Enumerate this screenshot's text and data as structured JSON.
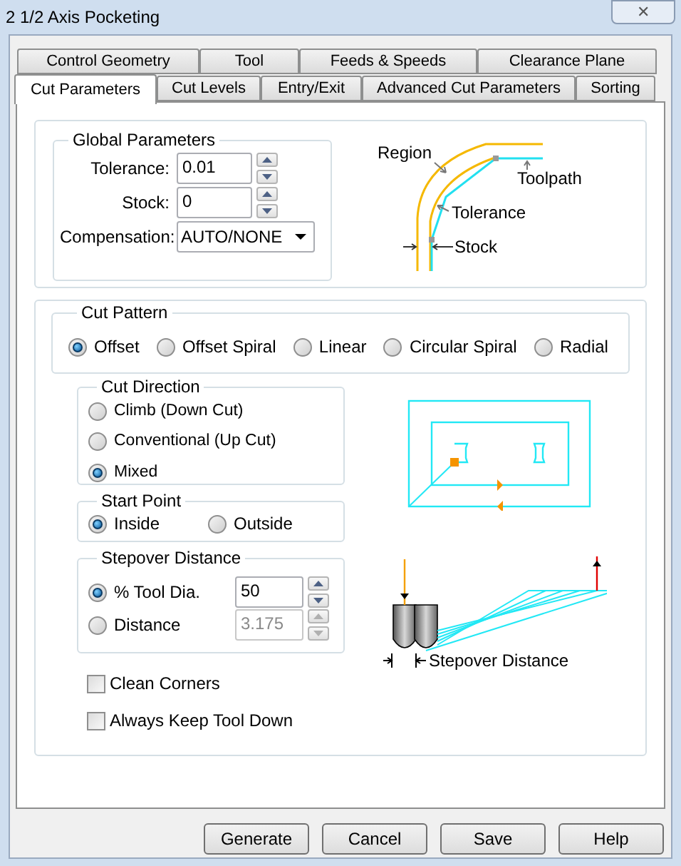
{
  "window": {
    "title": "2 1/2 Axis Pocketing",
    "close": "✕"
  },
  "tabs": [
    [
      {
        "label": "Control Geometry",
        "selected": false
      },
      {
        "label": "Tool",
        "selected": false
      },
      {
        "label": "Feeds & Speeds",
        "selected": false
      },
      {
        "label": "Clearance Plane",
        "selected": false
      }
    ],
    [
      {
        "label": "Cut Parameters",
        "selected": true
      },
      {
        "label": "Cut Levels",
        "selected": false
      },
      {
        "label": "Entry/Exit",
        "selected": false
      },
      {
        "label": "Advanced Cut Parameters",
        "selected": false
      },
      {
        "label": "Sorting",
        "selected": false
      }
    ]
  ],
  "global_parameters": {
    "title": "Global Parameters",
    "fields": [
      {
        "kind": "spinner",
        "label": "Tolerance:",
        "value": "0.01"
      },
      {
        "kind": "spinner",
        "label": "Stock:",
        "value": "0"
      },
      {
        "kind": "dropdown",
        "label": "Compensation:",
        "value": "AUTO/NONE"
      }
    ]
  },
  "region_diagram": {
    "labels": [
      "Region",
      "Toolpath",
      "Tolerance",
      "Stock"
    ]
  },
  "cut_pattern": {
    "title": "Cut Pattern",
    "options": [
      {
        "label": "Offset",
        "selected": true
      },
      {
        "label": "Offset Spiral",
        "selected": false
      },
      {
        "label": "Linear",
        "selected": false
      },
      {
        "label": "Circular Spiral",
        "selected": false
      },
      {
        "label": "Radial",
        "selected": false
      }
    ]
  },
  "cut_direction": {
    "title": "Cut Direction",
    "options": [
      {
        "label": "Climb (Down Cut)",
        "selected": false
      },
      {
        "label": "Conventional (Up Cut)",
        "selected": false
      },
      {
        "label": "Mixed",
        "selected": true
      }
    ]
  },
  "start_point": {
    "title": "Start Point",
    "options": [
      {
        "label": "Inside",
        "selected": true
      },
      {
        "label": "Outside",
        "selected": false
      }
    ]
  },
  "stepover_distance": {
    "title": "Stepover Distance",
    "options": [
      {
        "label": "% Tool Dia.",
        "selected": true,
        "value": "50",
        "disabled": false
      },
      {
        "label": "Distance",
        "selected": false,
        "value": "3.175",
        "disabled": true
      }
    ]
  },
  "checkboxes": [
    {
      "label": "Clean Corners",
      "checked": false
    },
    {
      "label": "Always Keep Tool Down",
      "checked": false
    }
  ],
  "stepover_diagram": {
    "label": "Stepover Distance"
  },
  "buttons": [
    "Generate",
    "Cancel",
    "Save",
    "Help"
  ]
}
